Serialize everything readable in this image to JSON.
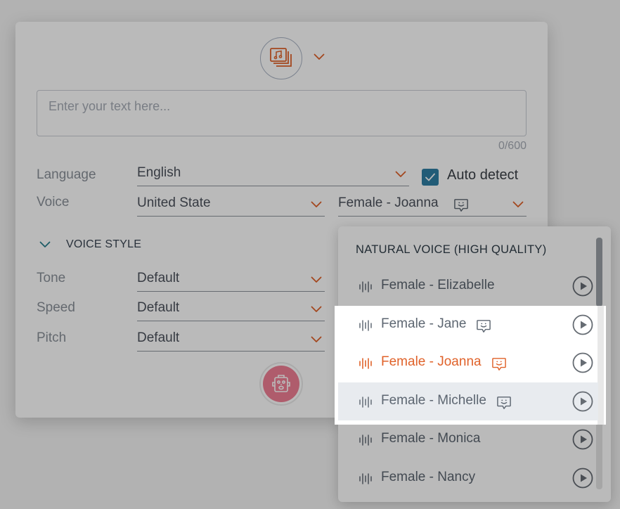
{
  "colors": {
    "accent": "#e0622a",
    "checkbox": "#2f7ea3",
    "robot_button": "#f07f94",
    "hover_row": "#e8ebef"
  },
  "top": {
    "media_icon": "music-stack-icon",
    "chevron_icon": "chevron-down-icon"
  },
  "textarea": {
    "placeholder": "Enter your text here...",
    "value": "",
    "counter": "0/600"
  },
  "language": {
    "label": "Language",
    "value": "English",
    "auto_detect_label": "Auto detect",
    "auto_detect_checked": true
  },
  "voice": {
    "label": "Voice",
    "region": "United State",
    "selected_voice": "Female - Joanna"
  },
  "voice_style": {
    "title": "VOICE STYLE",
    "fields": [
      {
        "label": "Tone",
        "value": "Default"
      },
      {
        "label": "Speed",
        "value": "Default"
      },
      {
        "label": "Pitch",
        "value": "Default"
      }
    ]
  },
  "generate_button_icon": "robot-icon",
  "dropdown": {
    "header": "NATURAL VOICE (HIGH QUALITY)",
    "options": [
      {
        "name": "Female - Elizabelle",
        "expressive": false,
        "selected": false
      },
      {
        "name": "Female - Jane",
        "expressive": true,
        "selected": false
      },
      {
        "name": "Female - Joanna",
        "expressive": true,
        "selected": true
      },
      {
        "name": "Female - Michelle",
        "expressive": true,
        "selected": false,
        "hovered": true
      },
      {
        "name": "Female - Monica",
        "expressive": false,
        "selected": false
      },
      {
        "name": "Female - Nancy",
        "expressive": false,
        "selected": false
      }
    ]
  }
}
